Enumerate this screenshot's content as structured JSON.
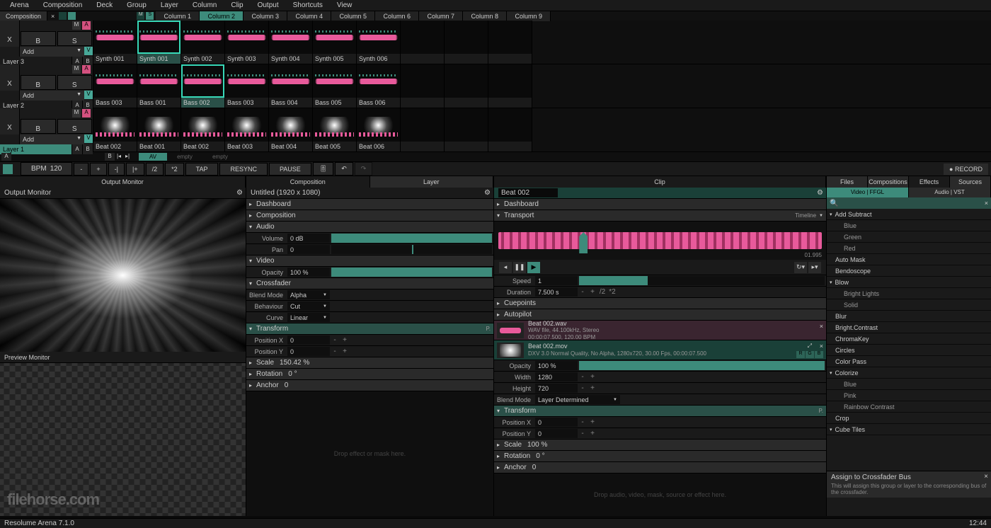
{
  "menu": [
    "Arena",
    "Composition",
    "Deck",
    "Group",
    "Layer",
    "Column",
    "Clip",
    "Output",
    "Shortcuts",
    "View"
  ],
  "compbar": {
    "name": "Composition",
    "columns": [
      "Column 1",
      "Column 2",
      "Column 3",
      "Column 4",
      "Column 5",
      "Column 6",
      "Column 7",
      "Column 8",
      "Column 9"
    ],
    "selected": 1
  },
  "layers": [
    {
      "name": "Layer 3",
      "clips": [
        "Synth 001",
        "Synth 001",
        "Synth 002",
        "Synth 003",
        "Synth 004",
        "Synth 005",
        "Synth 006"
      ],
      "selected": 1,
      "active": false,
      "type": "wave"
    },
    {
      "name": "Layer 2",
      "clips": [
        "Bass 003",
        "Bass 001",
        "Bass 002",
        "Bass 003",
        "Bass 004",
        "Bass 005",
        "Bass 006"
      ],
      "selected": 2,
      "active": false,
      "type": "wave"
    },
    {
      "name": "Layer 1",
      "clips": [
        "Beat 002",
        "Beat 001",
        "Beat 002",
        "Beat 003",
        "Beat 004",
        "Beat 005",
        "Beat 006"
      ],
      "selected": -1,
      "active": true,
      "type": "beat"
    }
  ],
  "btn_b": "B",
  "btn_s": "S",
  "btn_add": "Add",
  "btn_x": "X",
  "btn_m": "M",
  "btn_a": "A",
  "btn_v": "V",
  "tinyrow": {
    "av": "AV",
    "empty": "empty"
  },
  "bpm": {
    "label": "BPM",
    "value": "120",
    "ops": [
      "-",
      "+",
      "-|",
      "|+",
      "/2",
      "*2"
    ],
    "tap": "TAP",
    "resync": "RESYNC",
    "pause": "PAUSE",
    "record": "● RECORD"
  },
  "tabs_mid": [
    "Composition",
    "Layer"
  ],
  "tabs_right": [
    "Clip"
  ],
  "tabs_fx": [
    "Files",
    "Compositions",
    "Effects",
    "Sources"
  ],
  "outmon": "Output Monitor",
  "prevmon": "Preview Monitor",
  "comp": {
    "title": "Untitled (1920 x 1080)",
    "sections": {
      "dashboard": "Dashboard",
      "composition": "Composition",
      "audio": "Audio",
      "video": "Video",
      "crossfader": "Crossfader",
      "transform": "Transform",
      "scale": "Scale",
      "rotation": "Rotation",
      "anchor": "Anchor"
    },
    "volume": {
      "label": "Volume",
      "val": "0 dB"
    },
    "pan": {
      "label": "Pan",
      "val": "0"
    },
    "opacity": {
      "label": "Opacity",
      "val": "100 %"
    },
    "blendmode": {
      "label": "Blend Mode",
      "val": "Alpha"
    },
    "behaviour": {
      "label": "Behaviour",
      "val": "Cut"
    },
    "curve": {
      "label": "Curve",
      "val": "Linear"
    },
    "posx": {
      "label": "Position X",
      "val": "0"
    },
    "posy": {
      "label": "Position Y",
      "val": "0"
    },
    "scaleval": "150.42 %",
    "rot": "0 °",
    "anc": "0"
  },
  "clip": {
    "name": "Beat 002",
    "dashboard": "Dashboard",
    "transport": "Transport",
    "transport_mode": "Timeline",
    "time": "01.995",
    "speed": {
      "label": "Speed",
      "val": "1"
    },
    "duration": {
      "label": "Duration",
      "val": "7.500 s",
      "ops": [
        "-",
        "+",
        "/2",
        "*2"
      ]
    },
    "cuepoints": "Cuepoints",
    "autopilot": "Autopilot",
    "audio": {
      "name": "Beat 002.wav",
      "meta1": "WAV file, 44.100kHz, Stereo",
      "meta2": "00:00:07.500, 120.00 BPM"
    },
    "video": {
      "name": "Beat 002.mov",
      "meta": "DXV 3.0 Normal Quality, No Alpha, 1280x720, 30.00 Fps, 00:00:07.500"
    },
    "rgb": [
      "R",
      "G",
      "B"
    ],
    "opacity": {
      "label": "Opacity",
      "val": "100 %"
    },
    "width": {
      "label": "Width",
      "val": "1280"
    },
    "height": {
      "label": "Height",
      "val": "720"
    },
    "blendmode": {
      "label": "Blend Mode",
      "val": "Layer Determined"
    },
    "transform": "Transform",
    "posx": {
      "label": "Position X",
      "val": "0"
    },
    "posy": {
      "label": "Position Y",
      "val": "0"
    },
    "scale": {
      "label": "Scale",
      "val": "100 %"
    },
    "rotation": {
      "label": "Rotation",
      "val": "0 °"
    },
    "anchor": {
      "label": "Anchor",
      "val": "0"
    },
    "dropzone": "Drop audio, video, mask, source or effect here."
  },
  "comp_dropzone": "Drop effect or mask here.",
  "fx": {
    "subtabs": [
      "Video | FFGL",
      "Audio | VST"
    ],
    "items": [
      {
        "t": "Add Subtract",
        "g": true
      },
      {
        "t": "Blue",
        "s": true
      },
      {
        "t": "Green",
        "s": true
      },
      {
        "t": "Red",
        "s": true
      },
      {
        "t": "Auto Mask"
      },
      {
        "t": "Bendoscope"
      },
      {
        "t": "Blow",
        "g": true
      },
      {
        "t": "Bright Lights",
        "s": true
      },
      {
        "t": "Solid",
        "s": true
      },
      {
        "t": "Blur"
      },
      {
        "t": "Bright.Contrast"
      },
      {
        "t": "ChromaKey"
      },
      {
        "t": "Circles"
      },
      {
        "t": "Color Pass"
      },
      {
        "t": "Colorize",
        "g": true
      },
      {
        "t": "Blue",
        "s": true
      },
      {
        "t": "Pink",
        "s": true
      },
      {
        "t": "Rainbow Contrast",
        "s": true
      },
      {
        "t": "Crop"
      },
      {
        "t": "Cube Tiles",
        "g": true
      }
    ],
    "tooltip": {
      "title": "Assign to Crossfader Bus",
      "desc": "This will assign this group or layer to the corresponding bus of the crossfader."
    }
  },
  "status": {
    "app": "Resolume Arena 7.1.0",
    "time": "12:44"
  },
  "watermark": "filehorse.com"
}
